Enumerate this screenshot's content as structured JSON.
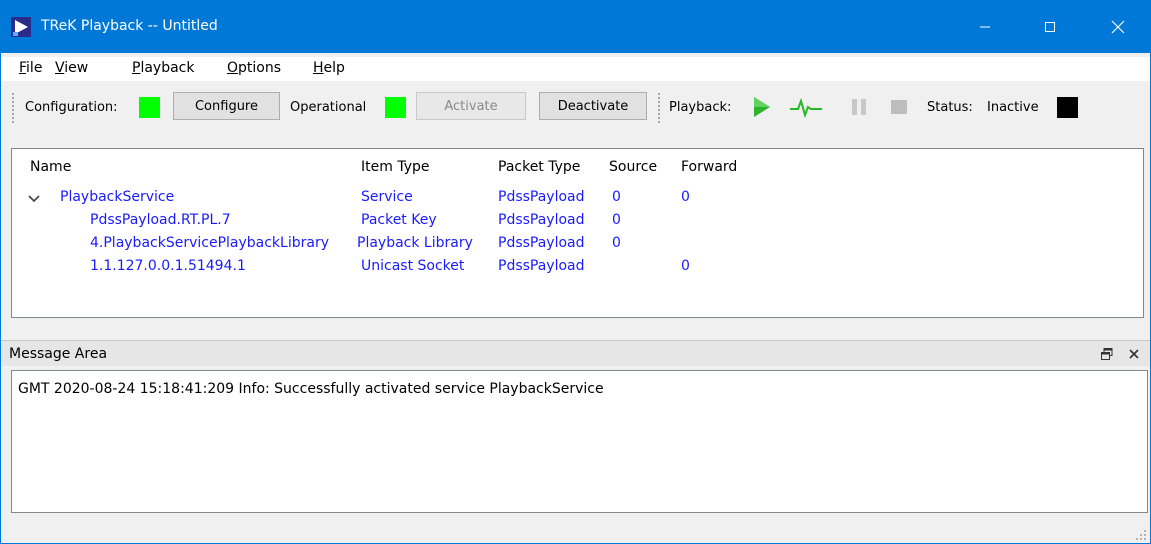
{
  "window": {
    "title": "TReK Playback -- Untitled"
  },
  "menu": [
    {
      "key": "F",
      "rest": "ile"
    },
    {
      "key": "V",
      "rest": "iew"
    },
    {
      "key": "P",
      "rest": "layback"
    },
    {
      "key": "O",
      "rest": "ptions"
    },
    {
      "key": "H",
      "rest": "elp"
    }
  ],
  "toolbar": {
    "configuration_label": "Configuration:",
    "configure_button": "Configure",
    "operational_label": "Operational",
    "activate_button": "Activate",
    "deactivate_button": "Deactivate",
    "playback_label": "Playback:",
    "status_label": "Status:",
    "status_value": "Inactive",
    "colors": {
      "config_led": "#00ff00",
      "operational_led": "#00ff00",
      "status_led": "#000000",
      "play_icon": "#2fb32f"
    },
    "icons": [
      "play-icon",
      "signal-icon",
      "pause-icon",
      "stop-icon"
    ]
  },
  "tree": {
    "columns": [
      "Name",
      "Item Type",
      "Packet Type",
      "Source",
      "Forward"
    ],
    "rows": [
      {
        "name": "PlaybackService",
        "item_type": "Service",
        "packet_type": "PdssPayload",
        "source": "0",
        "forward": "0",
        "expanded": true,
        "level": 0
      },
      {
        "name": "PdssPayload.RT.PL.7",
        "item_type": "Packet Key",
        "packet_type": "PdssPayload",
        "source": "0",
        "forward": "",
        "level": 1
      },
      {
        "name": "4.PlaybackServicePlaybackLibrary",
        "item_type": "Playback Library",
        "packet_type": "PdssPayload",
        "source": "0",
        "forward": "",
        "level": 1
      },
      {
        "name": "1.1.127.0.0.1.51494.1",
        "item_type": "Unicast Socket",
        "packet_type": "PdssPayload",
        "source": "",
        "forward": "0",
        "level": 1
      }
    ],
    "text_color": "#1a1aff"
  },
  "messages": {
    "title": "Message Area",
    "lines": [
      "GMT 2020-08-24 15:18:41:209  Info:  Successfully activated service PlaybackService"
    ]
  }
}
